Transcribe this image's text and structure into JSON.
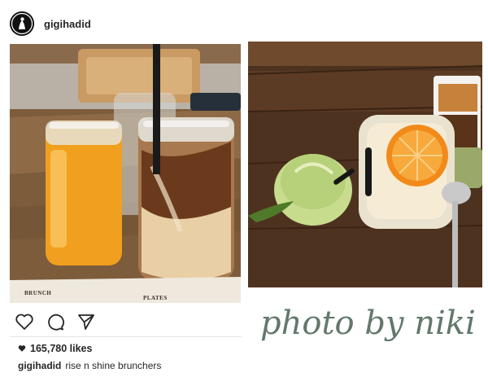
{
  "post": {
    "username": "gigihadid",
    "likes_text": "165,780 likes",
    "caption_user": "gigihadid",
    "caption_text": "rise n shine brunchers"
  },
  "photo_left": {
    "menu_text_left": "BRUNCH",
    "menu_text_right": "PLATES"
  },
  "actions": [
    "heart-icon",
    "comment-icon",
    "share-icon"
  ],
  "watermark": {
    "text": "photo by niki",
    "color": "#62786b"
  },
  "colors": {
    "text": "#262626",
    "juice": "#f5a623",
    "coffee": "#7a4a28",
    "wood": "#5a3a22"
  }
}
